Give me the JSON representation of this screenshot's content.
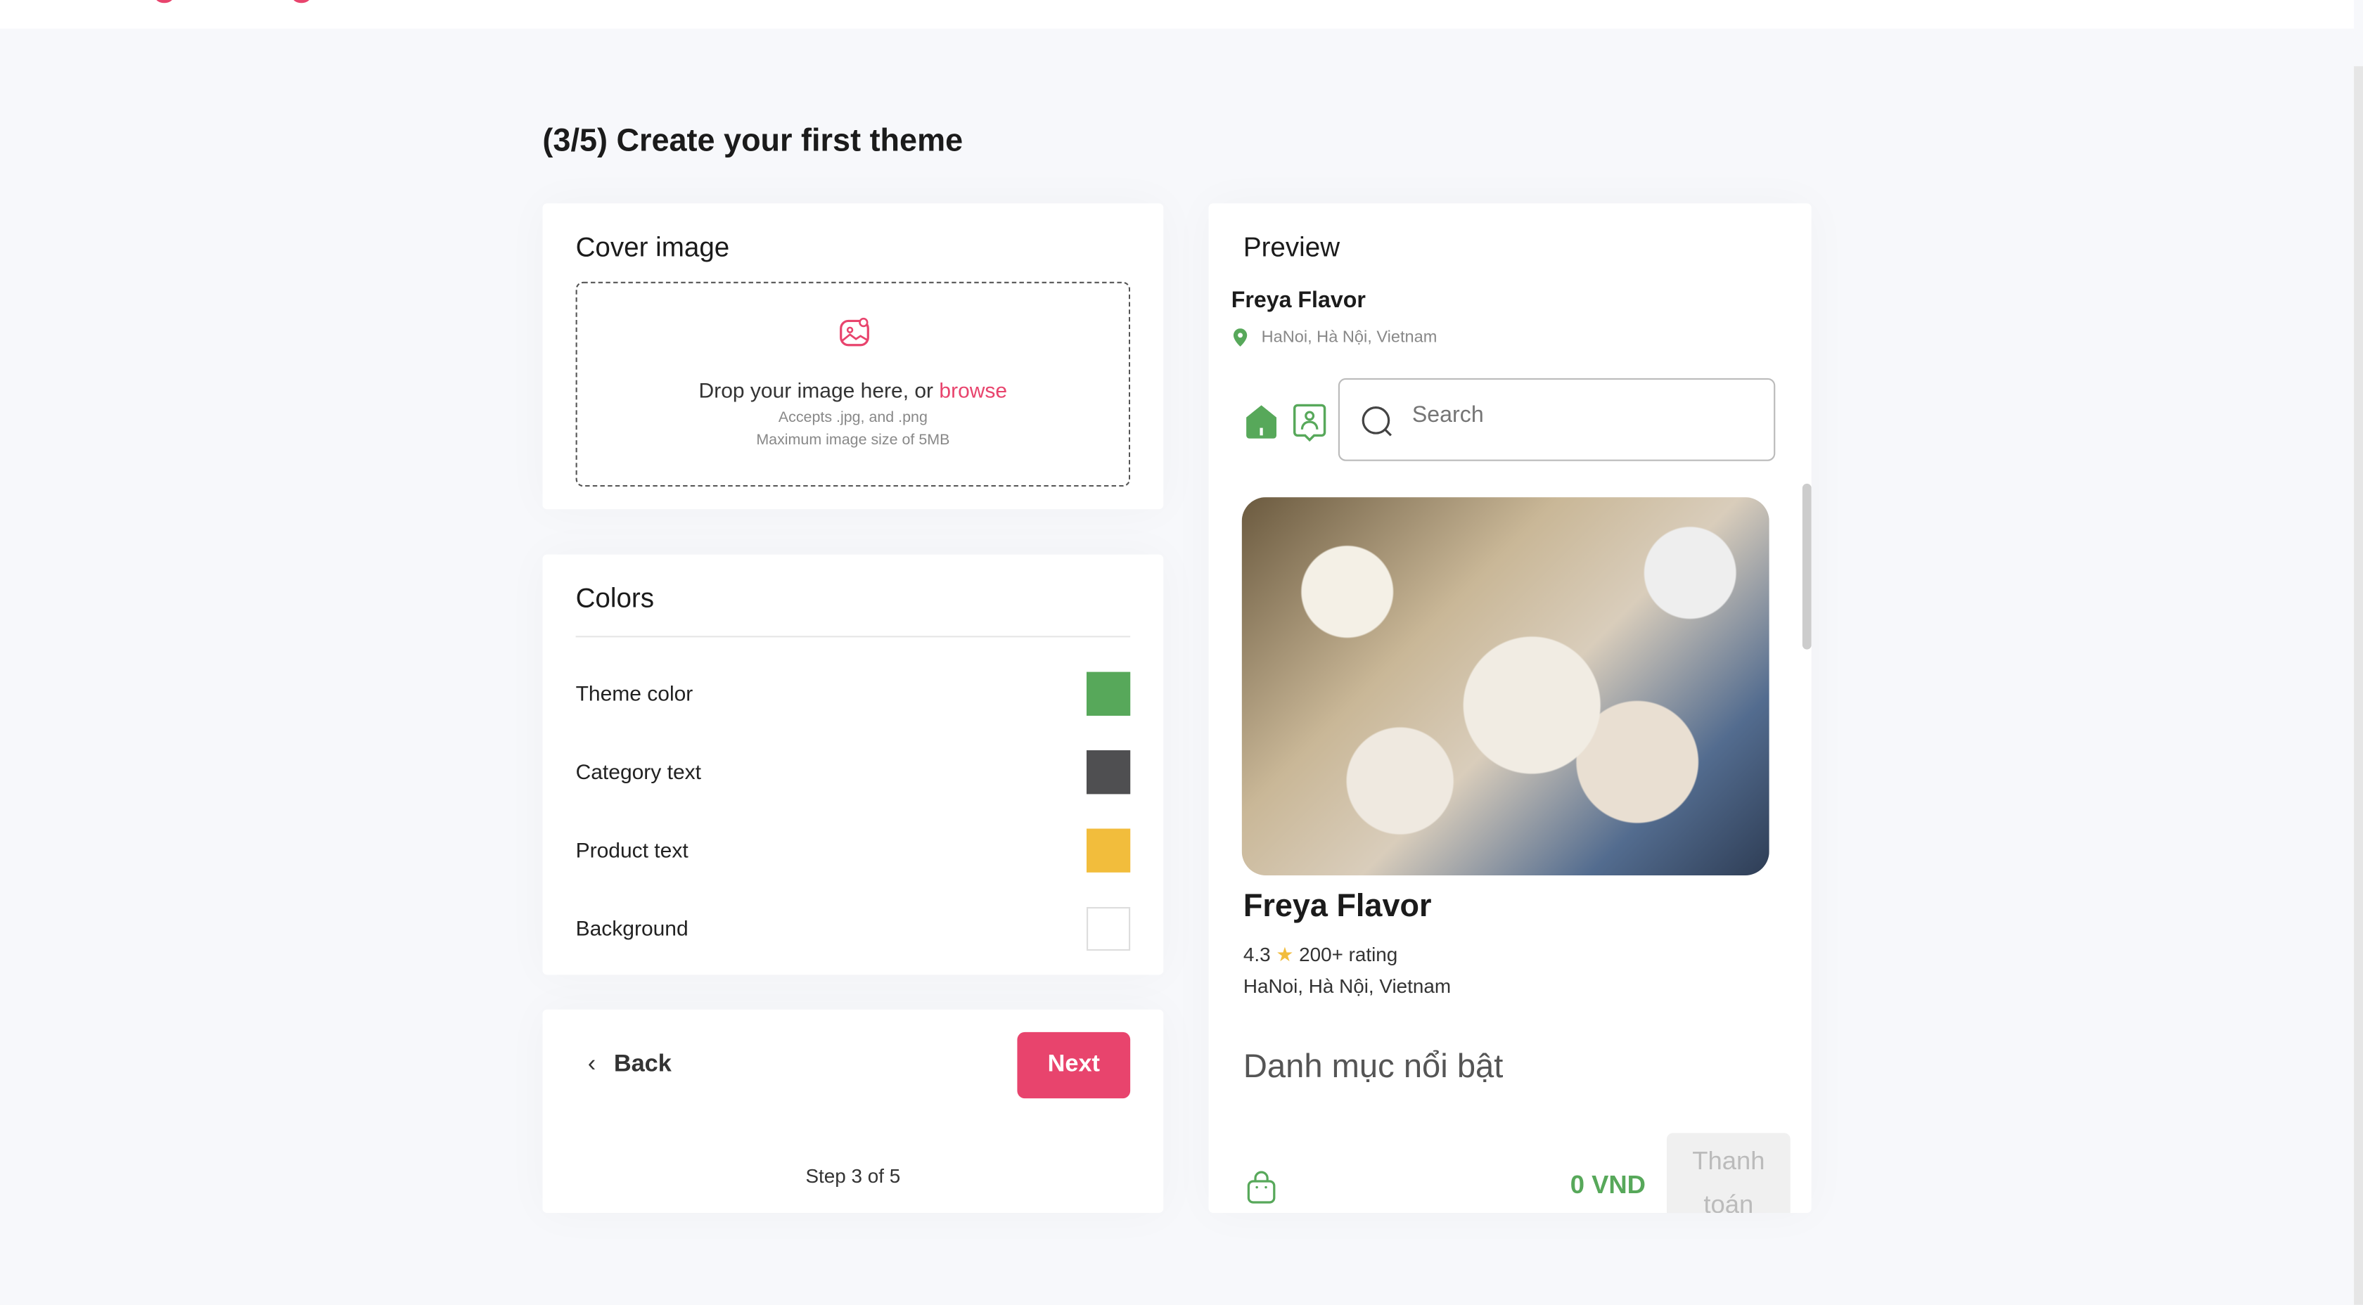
{
  "page": {
    "title": "(3/5) Create your first theme"
  },
  "cover": {
    "heading": "Cover image",
    "drop_text": "Drop your image here, or ",
    "browse": "browse",
    "accepts": "Accepts .jpg, and .png",
    "max_size": "Maximum image size of 5MB",
    "icon": "image-upload-icon"
  },
  "colors": {
    "heading": "Colors",
    "items": [
      {
        "label": "Theme color",
        "color": "#57a85a"
      },
      {
        "label": "Category text",
        "color": "#4f4f51"
      },
      {
        "label": "Product text",
        "color": "#f2bd3c"
      },
      {
        "label": "Background",
        "color": "#ffffff"
      }
    ]
  },
  "nav": {
    "back": "Back",
    "next": "Next",
    "step": "Step 3 of 5"
  },
  "preview": {
    "heading": "Preview",
    "store_name": "Freya Flavor",
    "location": "HaNoi, Hà Nội, Vietnam",
    "search_placeholder": "Search",
    "title": "Freya Flavor",
    "rating": "4.3",
    "rating_text": "200+ rating",
    "address": "HaNoi, Hà Nội, Vietnam",
    "featured": "Danh mục nổi bật",
    "total": "0 VND",
    "checkout": "Thanh toán",
    "accent": "#57a85a"
  }
}
